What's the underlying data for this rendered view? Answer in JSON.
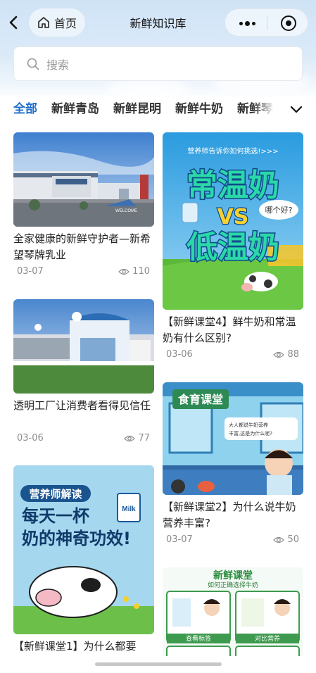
{
  "nav": {
    "home_label": "首页",
    "title": "新鲜知识库"
  },
  "search": {
    "placeholder": "搜索"
  },
  "tabs": [
    {
      "label": "全部",
      "active": true
    },
    {
      "label": "新鲜青岛",
      "active": false
    },
    {
      "label": "新鲜昆明",
      "active": false
    },
    {
      "label": "新鲜牛奶",
      "active": false
    },
    {
      "label": "新鲜琴岛",
      "active": false
    }
  ],
  "cards": [
    {
      "title": "全家健康的新鲜守护者—新希望琴牌乳业",
      "date": "03-07",
      "views": "110"
    },
    {
      "title": "【新鲜课堂4】鲜牛奶和常温奶有什么区别?",
      "date": "03-06",
      "views": "88",
      "image_text": {
        "top": "营养师告诉你如何挑选!>>>",
        "line1": "常温奶",
        "vs": "VS",
        "line2": "低温奶",
        "bubble": "哪个好?"
      }
    },
    {
      "title": "透明工厂让消费者看得见信任",
      "date": "03-06",
      "views": "77"
    },
    {
      "title": "【新鲜课堂2】为什么说牛奶营养丰富?",
      "date": "03-07",
      "views": "50",
      "image_text": {
        "banner": "食育课堂",
        "bubble": "大人都说牛奶营养丰富,这是为什么呢?"
      }
    },
    {
      "title": "【新鲜课堂1】为什么都要",
      "date": "",
      "views": "",
      "image_text": {
        "badge": "营养师解读",
        "line1": "每天一杯",
        "line2": "奶的神奇功效!",
        "carton": "Milk"
      }
    },
    {
      "title": "",
      "date": "",
      "views": "",
      "image_text": {
        "title": "新鲜课堂",
        "subtitle": "如何正确选择牛奶",
        "label1": "查看标签",
        "label2": "对比营养"
      }
    }
  ],
  "colors": {
    "accent": "#1f6fc9",
    "meta": "#8c8c8c"
  }
}
